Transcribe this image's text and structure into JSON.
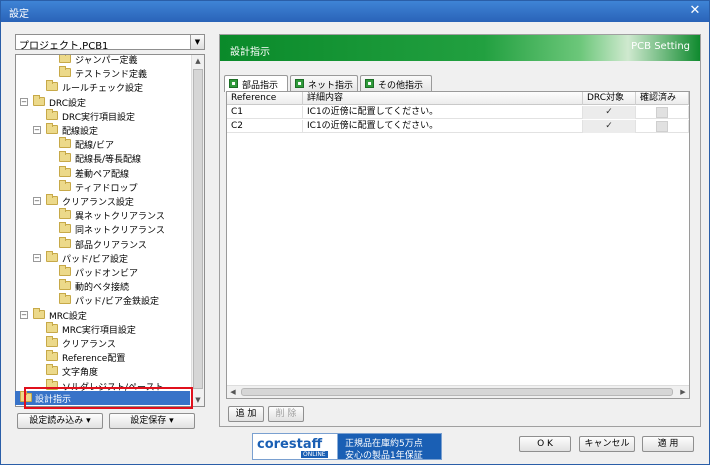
{
  "window": {
    "title": "設定"
  },
  "project": {
    "selected": "プロジェクト.PCB1"
  },
  "tree": {
    "items": [
      {
        "label": "ジャンパー定義",
        "depth": 2,
        "expander": ""
      },
      {
        "label": "テストランド定義",
        "depth": 2,
        "expander": ""
      },
      {
        "label": "ルールチェック設定",
        "depth": 1,
        "expander": ""
      },
      {
        "label": "DRC設定",
        "depth": 0,
        "expander": "−"
      },
      {
        "label": "DRC実行項目設定",
        "depth": 1,
        "expander": ""
      },
      {
        "label": "配線設定",
        "depth": 1,
        "expander": "−"
      },
      {
        "label": "配線/ビア",
        "depth": 2,
        "expander": ""
      },
      {
        "label": "配線長/等長配線",
        "depth": 2,
        "expander": ""
      },
      {
        "label": "差動ペア配線",
        "depth": 2,
        "expander": ""
      },
      {
        "label": "ティアドロップ",
        "depth": 2,
        "expander": ""
      },
      {
        "label": "クリアランス設定",
        "depth": 1,
        "expander": "−"
      },
      {
        "label": "異ネットクリアランス",
        "depth": 2,
        "expander": ""
      },
      {
        "label": "同ネットクリアランス",
        "depth": 2,
        "expander": ""
      },
      {
        "label": "部品クリアランス",
        "depth": 2,
        "expander": ""
      },
      {
        "label": "パッド/ビア設定",
        "depth": 1,
        "expander": "−"
      },
      {
        "label": "パッドオンビア",
        "depth": 2,
        "expander": ""
      },
      {
        "label": "動的ベタ接続",
        "depth": 2,
        "expander": ""
      },
      {
        "label": "パッド/ビア金鉄設定",
        "depth": 2,
        "expander": ""
      },
      {
        "label": "MRC設定",
        "depth": 0,
        "expander": "−"
      },
      {
        "label": "MRC実行項目設定",
        "depth": 1,
        "expander": ""
      },
      {
        "label": "クリアランス",
        "depth": 1,
        "expander": ""
      },
      {
        "label": "Reference配置",
        "depth": 1,
        "expander": ""
      },
      {
        "label": "文字角度",
        "depth": 1,
        "expander": ""
      },
      {
        "label": "ソルダレジスト/ペースト",
        "depth": 1,
        "expander": ""
      }
    ],
    "selected": "設計指示"
  },
  "left_buttons": {
    "load": "設定読み込み ▾",
    "save": "設定保存 ▾"
  },
  "banner": {
    "title": "設計指示",
    "subtitle": "PCB Setting"
  },
  "tabs": [
    {
      "label": "部品指示",
      "active": true
    },
    {
      "label": "ネット指示",
      "active": false
    },
    {
      "label": "その他指示",
      "active": false
    }
  ],
  "grid": {
    "headers": [
      "Reference",
      "詳細内容",
      "DRC対象",
      "確認済み"
    ],
    "rows": [
      {
        "reference": "C1",
        "detail": "IC1の近傍に配置してください。",
        "drc": "✓",
        "confirmed": ""
      },
      {
        "reference": "C2",
        "detail": "IC1の近傍に配置してください。",
        "drc": "✓",
        "confirmed": ""
      }
    ]
  },
  "grid_buttons": {
    "add": "追 加",
    "delete": "削 除"
  },
  "ad": {
    "logo": "corestaff",
    "logo_sub": "ONLINE",
    "line1": "正規品在庫約5万点",
    "line2": "安心の製品1年保証"
  },
  "footer": {
    "ok": "O K",
    "cancel": "キャンセル",
    "apply": "適 用"
  }
}
